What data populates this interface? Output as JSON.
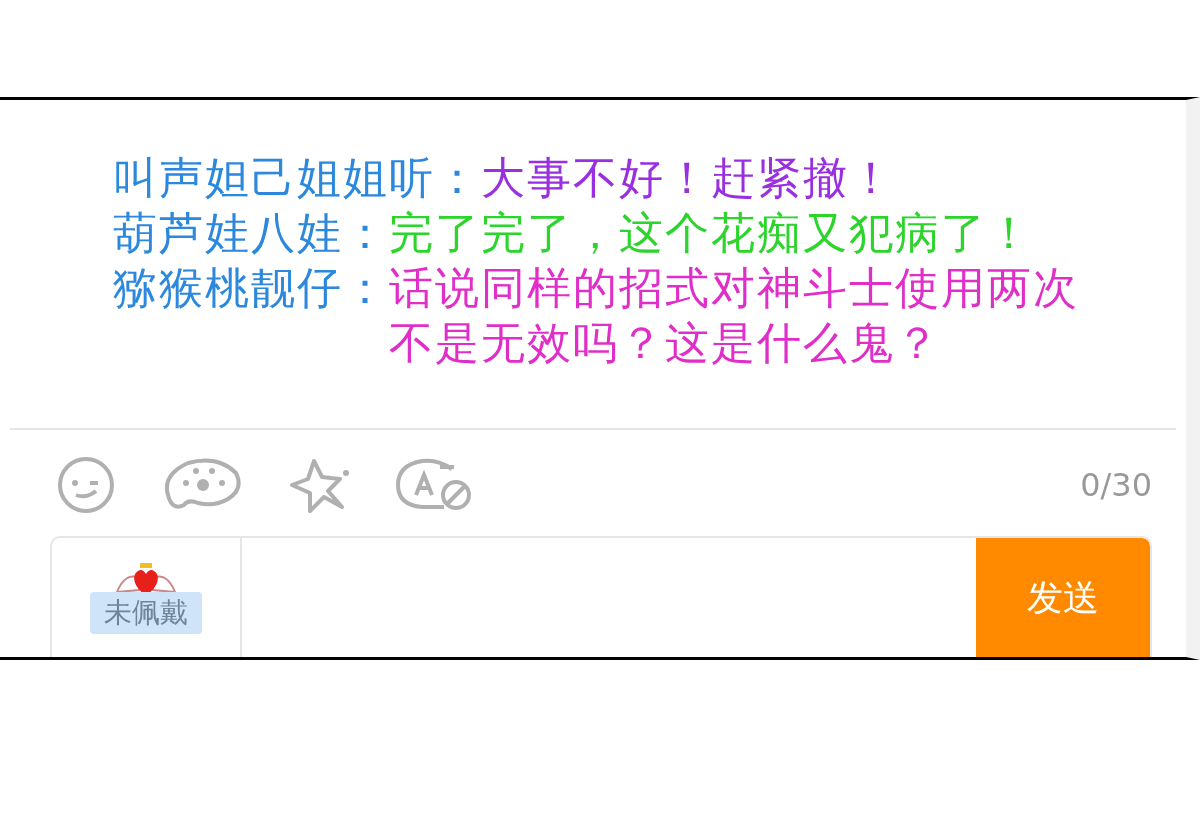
{
  "messages": [
    {
      "name": "叫声妲己姐姐听：",
      "text": "大事不好！赶紧撤！",
      "color": "#9a2fe0"
    },
    {
      "name": "葫芦娃八娃：",
      "text": "完了完了，这个花痴又犯病了！",
      "color": "#2cd42c"
    },
    {
      "name": "猕猴桃靓仔：",
      "text": "话说同样的招式对神斗士使用两次不是无效吗？这是什么鬼？",
      "color": "#e02ec8"
    }
  ],
  "counter": "0/30",
  "badge": "未佩戴",
  "send_button": "发送"
}
